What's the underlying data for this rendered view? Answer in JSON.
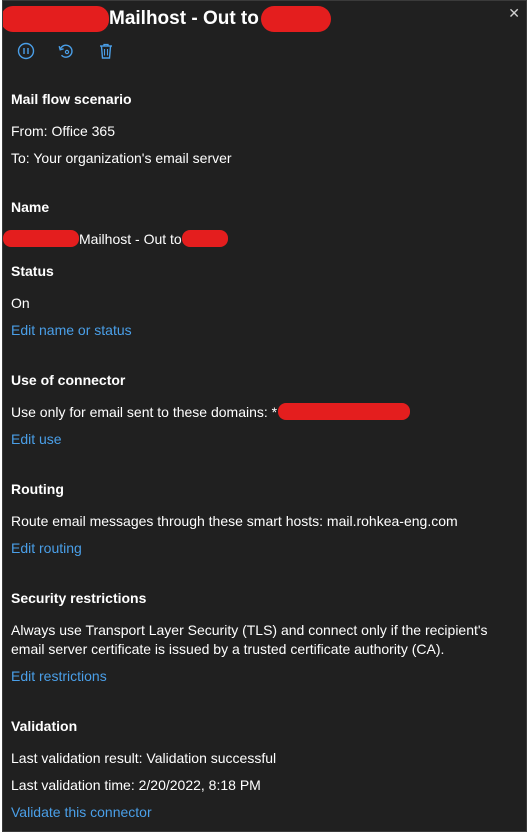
{
  "window": {
    "title_text": "Mailhost - Out to",
    "close_glyph": "✕"
  },
  "toolbar": {
    "icons": [
      "pause-circle-icon",
      "refresh-icon",
      "trash-icon"
    ],
    "accent": "#4a9fe8"
  },
  "sections": {
    "mail_flow": {
      "heading": "Mail flow scenario",
      "from": "From: Office 365",
      "to": "To: Your organization's email server"
    },
    "name": {
      "heading": "Name",
      "value": "Mailhost - Out to"
    },
    "status": {
      "heading": "Status",
      "value": "On",
      "edit_link": "Edit name or status"
    },
    "use_of_connector": {
      "heading": "Use of connector",
      "value": "Use only for email sent to these domains: *",
      "edit_link": "Edit use"
    },
    "routing": {
      "heading": "Routing",
      "value": "Route email messages through these smart hosts: mail.rohkea-eng.com",
      "edit_link": "Edit routing"
    },
    "security": {
      "heading": "Security restrictions",
      "value": "Always use Transport Layer Security (TLS) and connect only if the recipient's email server certificate is issued by a trusted certificate authority (CA).",
      "edit_link": "Edit restrictions"
    },
    "validation": {
      "heading": "Validation",
      "result": "Last validation result: Validation successful",
      "time": "Last validation time: 2/20/2022, 8:18 PM",
      "validate_link": "Validate this connector"
    }
  },
  "colors": {
    "background": "#202020",
    "link": "#4a9fe8",
    "redaction": "#e41e1e"
  }
}
